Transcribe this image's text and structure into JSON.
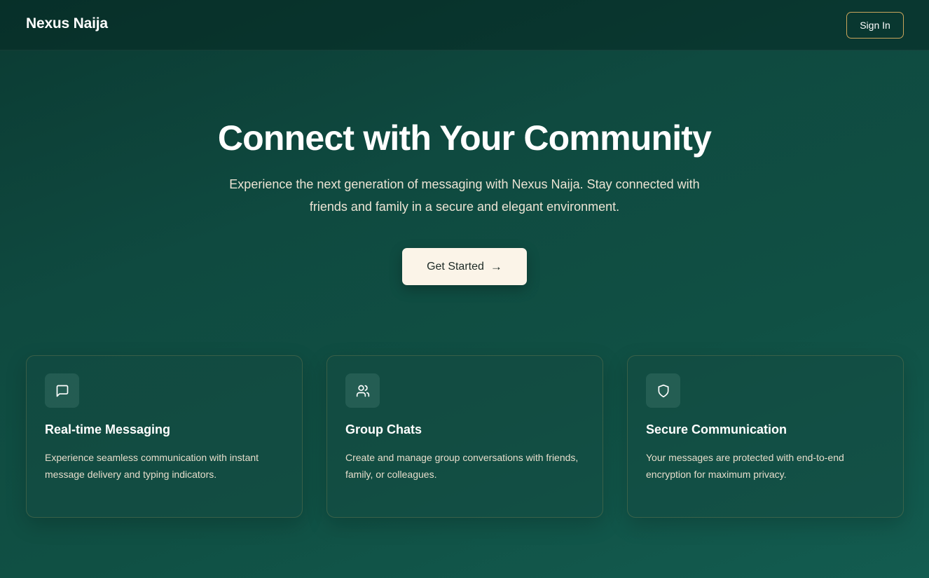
{
  "header": {
    "brand": "Nexus Naija",
    "signin_label": "Sign In"
  },
  "hero": {
    "title": "Connect with Your Community",
    "subtitle": "Experience the next generation of messaging with Nexus Naija. Stay connected with friends and family in a secure and elegant environment.",
    "cta_label": "Get Started",
    "cta_icon": "arrow-right-icon"
  },
  "features": [
    {
      "icon": "message-square-icon",
      "title": "Real-time Messaging",
      "description": "Experience seamless communication with instant message delivery and typing indicators."
    },
    {
      "icon": "users-icon",
      "title": "Group Chats",
      "description": "Create and manage group conversations with friends, family, or colleagues."
    },
    {
      "icon": "shield-icon",
      "title": "Secure Communication",
      "description": "Your messages are protected with end-to-end encryption for maximum privacy."
    }
  ],
  "colors": {
    "background": "#0f4a40",
    "accent_border": "#c9a55c",
    "cta_background": "#fbf4e8",
    "text": "#ffffff"
  }
}
